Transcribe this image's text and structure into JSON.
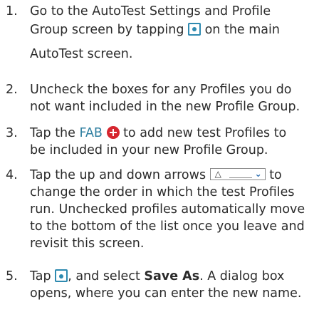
{
  "steps": [
    {
      "number": "1.",
      "line1": "Go to the AutoTest Settings and Profile",
      "line2_before": "Group screen by tapping ",
      "line2_after": " on the main",
      "line3": "AutoTest screen."
    },
    {
      "number": "2.",
      "line1": "Uncheck the boxes for any Profiles you do",
      "line2": "not want included in the new Profile Group."
    },
    {
      "number": "3.",
      "line1_before": "Tap the ",
      "fab_label": "FAB",
      "line1_after": " to add new test Profiles to",
      "line2": "be included in your new Profile Group."
    },
    {
      "number": "4.",
      "line1_before": "Tap the up and down arrows ",
      "line1_after": " to",
      "line2": "change the order in which the test Profiles",
      "line3": "run. Unchecked profiles automatically move",
      "line4": "to the bottom of the list once you leave and",
      "line5": "revisit this screen."
    },
    {
      "number": "5.",
      "line1_before": "Tap ",
      "line1_middle": ", and select ",
      "save_as": "Save As",
      "line1_after": ". A dialog box",
      "line2": "opens, where you can enter the new name."
    }
  ],
  "icons": {
    "settings_group": "profile-group-settings-icon",
    "fab": "add-fab-icon",
    "reorder": "up-down-arrows-icon",
    "menu": "save-menu-icon"
  },
  "colors": {
    "text": "#2b2b2b",
    "link": "#2f7fa0",
    "icon_blue": "#2e8ab0",
    "fab_red": "#d6262f"
  }
}
